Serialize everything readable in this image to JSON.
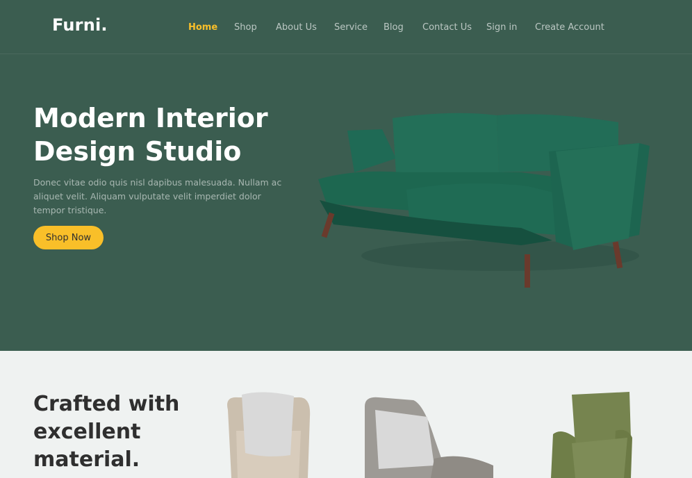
{
  "header": {
    "brand": "Furni.",
    "nav": [
      {
        "label": "Home",
        "active": true
      },
      {
        "label": "Shop",
        "active": false
      },
      {
        "label": "About Us",
        "active": false
      },
      {
        "label": "Service",
        "active": false
      },
      {
        "label": "Blog",
        "active": false
      },
      {
        "label": "Contact Us",
        "active": false
      },
      {
        "label": "Sign in",
        "active": false
      },
      {
        "label": "Create Account",
        "active": false
      }
    ]
  },
  "hero": {
    "title": "Modern Interior Design Studio",
    "description": "Donec vitae odio quis nisl dapibus malesuada. Nullam ac aliquet velit. Aliquam vulputate velit imperdiet dolor tempor tristique.",
    "cta_label": "Shop Now",
    "image": "green-velvet-sofa"
  },
  "section_products": {
    "heading": "Crafted with excellent material.",
    "products": [
      {
        "image": "beige-armchair-with-pillow"
      },
      {
        "image": "grey-lounge-chair-with-pillow"
      },
      {
        "image": "olive-green-armchair"
      }
    ]
  },
  "colors": {
    "brand_green": "#3b5d50",
    "accent_yellow": "#f9bf29",
    "page_bg": "#eff2f1",
    "text_dark": "#2f2f2f"
  }
}
